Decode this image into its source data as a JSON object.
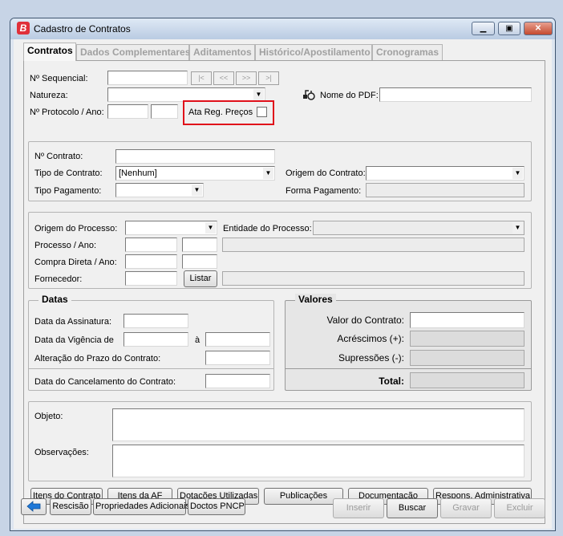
{
  "window": {
    "title": "Cadastro de Contratos",
    "app_icon_letter": "B"
  },
  "tabs": [
    {
      "label": "Contratos",
      "active": true
    },
    {
      "label": "Dados Complementares",
      "active": false
    },
    {
      "label": "Aditamentos",
      "active": false
    },
    {
      "label": "Histórico/Apostilamento",
      "active": false
    },
    {
      "label": "Cronogramas",
      "active": false
    }
  ],
  "header": {
    "sequencial_label": "Nº Sequencial:",
    "natureza_label": "Natureza:",
    "protocolo_label": "Nº Protocolo / Ano:",
    "ata_label": "Ata Reg. Preços",
    "pdf_label": "Nome do PDF:",
    "nav": [
      "|<",
      "<<",
      ">>",
      ">|"
    ]
  },
  "contrato": {
    "numero_label": "Nº Contrato:",
    "tipo_label": "Tipo de Contrato:",
    "tipo_value": "[Nenhum]",
    "pagamento_label": "Tipo Pagamento:",
    "origem_label": "Origem do Contrato:",
    "forma_label": "Forma Pagamento:"
  },
  "processo": {
    "origem_label": "Origem do Processo:",
    "entidade_label": "Entidade do Processo:",
    "processo_label": "Processo / Ano:",
    "compra_label": "Compra Direta / Ano:",
    "fornecedor_label": "Fornecedor:",
    "listar_label": "Listar"
  },
  "datas": {
    "title": "Datas",
    "assinatura_label": "Data da Assinatura:",
    "vigencia_label": "Data da Vigência de",
    "a_label": "à",
    "alteracao_label": "Alteração do Prazo do Contrato:",
    "cancelamento_label": "Data do Cancelamento do Contrato:"
  },
  "valores": {
    "title": "Valores",
    "valor_label": "Valor do Contrato:",
    "acrescimos_label": "Acréscimos (+):",
    "supressoes_label": "Supressões (-):",
    "total_label": "Total:"
  },
  "textos": {
    "objeto_label": "Objeto:",
    "observacoes_label": "Observações:"
  },
  "action_buttons": [
    "Itens do Contrato",
    "Itens da AF",
    "Dotações Utilizadas",
    "Publicações",
    "Documentação",
    "Respons. Administrativa"
  ],
  "footer": {
    "rescisao": "Rescisão",
    "propriedades": "Propriedades Adicionais",
    "doctos": "Doctos PNCP",
    "inserir": "Inserir",
    "buscar": "Buscar",
    "gravar": "Gravar",
    "excluir": "Excluir"
  },
  "colors": {
    "highlight": "#e0101a",
    "back_arrow": "#1e78d8",
    "brand": "#e0303a"
  }
}
